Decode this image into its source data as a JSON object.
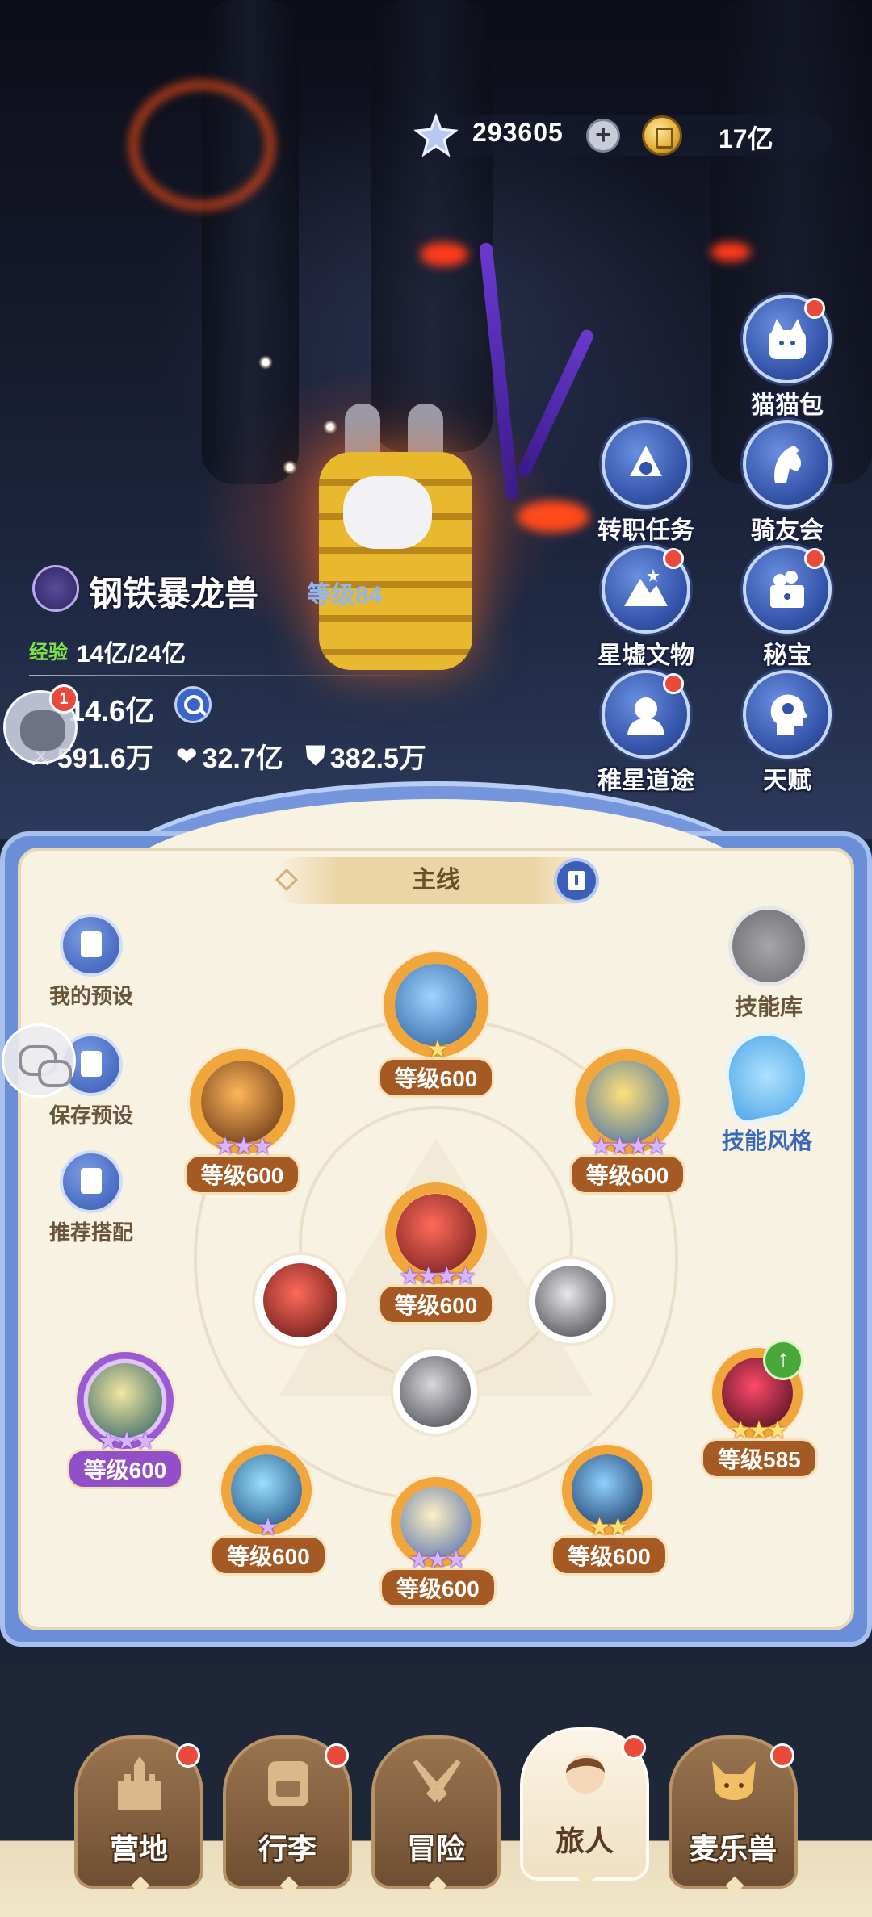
{
  "currency": {
    "gems": "293605",
    "plus": "+",
    "coins": "17亿"
  },
  "side_menu": [
    {
      "label": "猫猫包",
      "icon": "cat-bag-icon",
      "dot": true
    },
    {
      "label": "转职任务",
      "icon": "class-change-icon",
      "dot": false
    },
    {
      "label": "骑友会",
      "icon": "horse-icon",
      "dot": false
    },
    {
      "label": "星墟文物",
      "icon": "mountain-icon",
      "dot": true
    },
    {
      "label": "秘宝",
      "icon": "treasure-icon",
      "dot": true
    },
    {
      "label": "稚星道途",
      "icon": "star-path-icon",
      "dot": true
    },
    {
      "label": "天赋",
      "icon": "talent-head-icon",
      "dot": false
    }
  ],
  "character": {
    "name": "钢铁暴龙兽",
    "level": "等级84",
    "exp_label": "经验",
    "exp_value": "14亿/24亿",
    "power": "14.6亿",
    "stats": [
      {
        "icon": "attack-icon",
        "glyph": "⚔",
        "value": "591.6万"
      },
      {
        "icon": "heart-icon",
        "glyph": "❤",
        "value": "32.7亿"
      },
      {
        "icon": "shield-icon",
        "glyph": "⛊",
        "value": "382.5万"
      }
    ],
    "avatar_badge": "1"
  },
  "panel": {
    "tab_label": "主线",
    "left_buttons": [
      {
        "label": "我的预设"
      },
      {
        "label": "保存预设"
      },
      {
        "label": "推荐搭配"
      }
    ],
    "skill_library": "技能库",
    "skill_style": "技能风格",
    "skills": [
      {
        "level": "等级600",
        "stars": "★",
        "star_color": "gold",
        "colors": [
          "#9fd4ff",
          "#2a5a9a"
        ]
      },
      {
        "level": "等级600",
        "stars": "★★★",
        "star_color": "purple",
        "colors": [
          "#ffb65a",
          "#5a2a10"
        ]
      },
      {
        "level": "等级600",
        "stars": "★★★★",
        "star_color": "purple",
        "colors": [
          "#ffe07a",
          "#3a6aa8"
        ]
      },
      {
        "level": "等级600",
        "stars": "★★★★",
        "star_color": "purple",
        "colors": [
          "#ff6a5a",
          "#6a1a1a"
        ]
      },
      {
        "level": "",
        "stars": "",
        "star_color": "purple",
        "colors": [
          "#ff6a5a",
          "#5a1414"
        ]
      },
      {
        "level": "",
        "stars": "",
        "star_color": "purple",
        "colors": [
          "#e8e8ea",
          "#3a3a40"
        ]
      },
      {
        "level": "",
        "stars": "",
        "star_color": "purple",
        "colors": [
          "#d8d8dc",
          "#404048"
        ]
      },
      {
        "level": "等级600",
        "stars": "★★★",
        "star_color": "purple",
        "colors": [
          "#f2e7a0",
          "#2a5e66"
        ]
      },
      {
        "level": "等级585",
        "stars": "★★★",
        "star_color": "gold",
        "colors": [
          "#ff4a6a",
          "#3a0a1a"
        ]
      },
      {
        "level": "等级600",
        "stars": "★",
        "star_color": "purple",
        "colors": [
          "#9ae0ff",
          "#1a4a7a"
        ]
      },
      {
        "level": "等级600",
        "stars": "★★★",
        "star_color": "purple",
        "colors": [
          "#fff1c0",
          "#4a6ab0"
        ]
      },
      {
        "level": "等级600",
        "stars": "★★",
        "star_color": "gold",
        "colors": [
          "#8fd0ff",
          "#14305a"
        ]
      }
    ]
  },
  "nav": [
    {
      "label": "营地",
      "icon": "castle-icon",
      "active": false
    },
    {
      "label": "行李",
      "icon": "backpack-icon",
      "active": false
    },
    {
      "label": "冒险",
      "icon": "crossed-swords-icon",
      "active": false
    },
    {
      "label": "旅人",
      "icon": "traveler-icon",
      "active": true
    },
    {
      "label": "麦乐兽",
      "icon": "pet-cat-icon",
      "active": false
    }
  ]
}
